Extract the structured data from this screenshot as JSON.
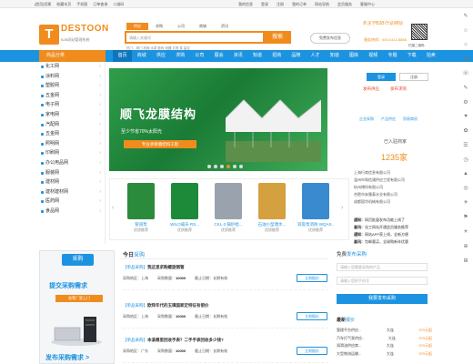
{
  "topbar": {
    "left": [
      "[首页]切换",
      "收藏本页",
      "手机版",
      "订单查询",
      "二维码"
    ],
    "right": [
      "我的信息",
      "登录",
      "注册",
      "我的订单",
      "网站导航",
      "会员服务",
      "客服中心"
    ]
  },
  "header": {
    "logo_mark": "T",
    "logo_text": "DESTOON",
    "logo_sub": "B2B网站管理系统",
    "search_tabs": [
      "供应",
      "求购",
      "公司",
      "商城",
      "资讯"
    ],
    "search_placeholder": "请输入关键词",
    "search_button": "搜索",
    "hot_words": "热门：阀门  机械  水泵  数码  电器  灯具  泵  监控",
    "free_post": "免费发布信息",
    "slogan": "专注于B2B行业网站",
    "hotline": "服务热线：400-0411-8888",
    "qr_label": "扫描二维码"
  },
  "nav": {
    "category_label": "商品分类",
    "items": [
      "首页",
      "商城",
      "供应",
      "求购",
      "公司",
      "展会",
      "资讯",
      "知道",
      "招商",
      "品牌",
      "人才",
      "知道",
      "图库",
      "视频",
      "专题",
      "下载",
      "拍卖"
    ],
    "active_index": 0
  },
  "sidebar": {
    "items": [
      "化工网",
      "涂料网",
      "塑胶网",
      "五金网",
      "电子网",
      "家电网",
      "汽配网",
      "五金网",
      "照明网",
      "印刷网",
      "办公用品网",
      "服装网",
      "建材网",
      "建材建材网",
      "医药网",
      "食品网"
    ]
  },
  "banner": {
    "title": "顺飞龙膜结构",
    "subtitle": "至少节省70%太阳光",
    "strip": "专业承接膜结构工程"
  },
  "products": [
    {
      "name": "管道泵",
      "sub": "优质推荐",
      "color": "#2a8b3c"
    },
    {
      "name": "WILO威乐 RS...",
      "sub": "优质推荐",
      "color": "#1d8a3a"
    },
    {
      "name": "CKL-3 锅炉给...",
      "sub": "优质推荐",
      "color": "#9aa3ad"
    },
    {
      "name": "石油小型潜水...",
      "sub": "优质推荐",
      "color": "#d5a040"
    },
    {
      "name": "双吸泵消防 WQAS...",
      "sub": "优质推荐",
      "color": "#3a8ad0"
    }
  ],
  "right_panel": {
    "login": "登录",
    "register": "注册",
    "pub_supply": "发布供应",
    "pub_buy": "发布求购",
    "tags": [
      "企业采购",
      "产品供应",
      "贸易商机"
    ],
    "registered_label": "已入驻商家",
    "registered_count": "1235家",
    "companies": [
      "上海行商信息有限公司",
      "温州市和信通供应工程有限公司",
      "杭州博科有限公司",
      "合肥市安雅泰水业有限公司",
      "成都国华机械有限公司"
    ],
    "notices": [
      {
        "label": "通知：",
        "text": "网页批量发布功能上线了"
      },
      {
        "label": "喜讯：",
        "text": "化工网站开通会员服务推荐"
      },
      {
        "label": "通知：",
        "text": "网站APP获上线，全新方便"
      },
      {
        "label": "喜讯：",
        "text": "包邮惠买，全球购新年优惠"
      }
    ]
  },
  "side_icons": [
    "✎",
    "☆",
    "⌂",
    "✉",
    "☏",
    "✎",
    "⚙",
    "♥",
    "✿",
    "☰",
    "◷",
    "▲",
    "◎",
    "✈",
    "⚑",
    "☀",
    "⊕",
    "⊞"
  ],
  "left_banner": {
    "caption": "采购",
    "line1": "提交采购需求",
    "line2": "坐等厂家上门",
    "line3": "发布采购需求 >"
  },
  "today": {
    "label_prefix": "今日",
    "label_highlight": "采购",
    "requests": [
      {
        "tag": "【单品采购】",
        "title": "我这里求购螺旋钢管",
        "area": "采购地区：上海",
        "qty_label": "采购数量：",
        "qty": "10000",
        "deadline": "截止日期：长期有效",
        "button": "立刻报价"
      },
      {
        "tag": "【单品采购】",
        "title": "欧拜年代的玉璜国家定特征有偿价",
        "area": "采购地区：上海",
        "qty_label": "采购数量：",
        "qty": "10000",
        "deadline": "截止日期：长期有效",
        "button": "立刻报价"
      },
      {
        "tag": "【单品采购】",
        "title": "本溪哪里回收手表？二手手表回收多少钱?",
        "area": "采购地区：广东",
        "qty_label": "采购数量：",
        "qty": "10000",
        "deadline": "截止日期：长期有效",
        "button": "立刻报价"
      }
    ]
  },
  "free_pub": {
    "head_prefix": "免费",
    "head_highlight": "发布采购",
    "field1": "请输入您需要采购的产品",
    "field2": "请输入您的手机号",
    "button": "我要发布采购",
    "latest_prefix": "最新",
    "latest_highlight": "报价",
    "rows": [
      {
        "name": "管理平台供应...",
        "city": "大连",
        "amount": "379元起"
      },
      {
        "name": "汽车打气泵供应...",
        "city": "大连",
        "amount": "379元起"
      },
      {
        "name": "润滑油供应商...",
        "city": "大连",
        "amount": "379元起"
      },
      {
        "name": "大型物流运输...",
        "city": "大连",
        "amount": "379元起"
      }
    ]
  },
  "colors": {
    "accent_orange": "#f08c1e",
    "nav_blue": "#1c93e0"
  }
}
